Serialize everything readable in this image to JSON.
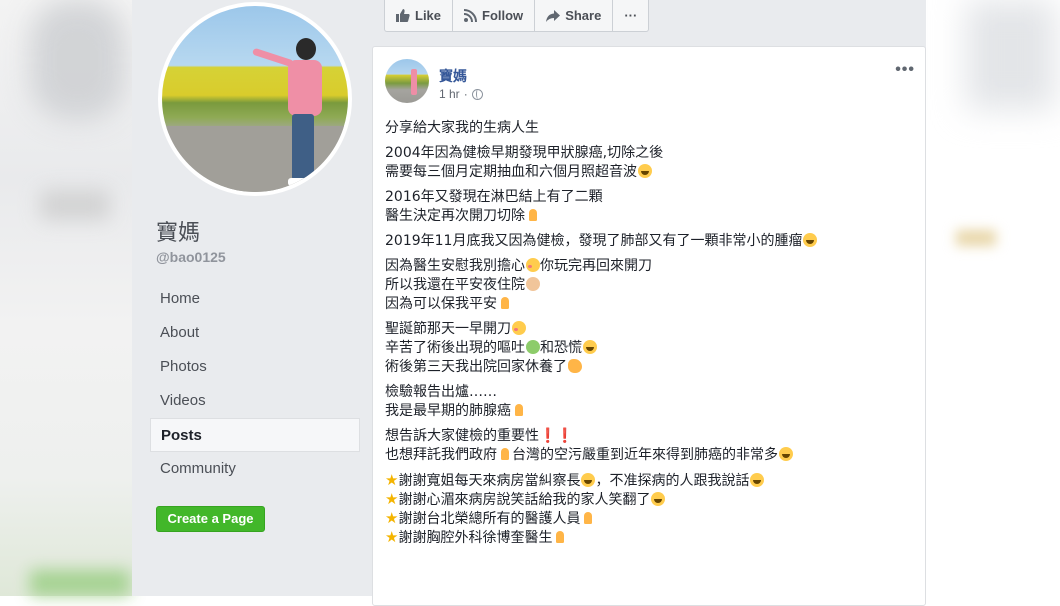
{
  "sidebar": {
    "page_name": "寶媽",
    "handle": "@bao0125",
    "nav": [
      "Home",
      "About",
      "Photos",
      "Videos",
      "Posts",
      "Community"
    ],
    "active_index": 4,
    "create_page_label": "Create a Page"
  },
  "actions": {
    "like": "Like",
    "follow": "Follow",
    "share": "Share",
    "more": "···"
  },
  "post": {
    "author": "寶媽",
    "time": "1 hr",
    "privacy_icon": "globe-icon",
    "lines": {
      "p1": "分享給大家我的生病人生",
      "p2a": "2004年因為健檢早期發現甲狀腺癌,切除之後",
      "p2b": "需要每三個月定期抽血和六個月照超音波",
      "p3a": "2016年又發現在淋巴結上有了二顆",
      "p3b": "醫生決定再次開刀切除",
      "p4": "2019年11月底我又因為健檢，發現了肺部又有了一顆非常小的腫瘤",
      "p5a1": "因為醫生安慰我別擔心",
      "p5a2": "你玩完再回來開刀",
      "p5b": "所以我還在平安夜住院",
      "p5c": "因為可以保我平安",
      "p6a": "聖誕節那天一早開刀",
      "p6b1": "辛苦了術後出現的嘔吐",
      "p6b2": "和恐慌",
      "p6c": "術後第三天我出院回家休養了",
      "p7a": "檢驗報告出爐……",
      "p7b": "我是最早期的肺腺癌",
      "p8a": "想告訴大家健檢的重要性",
      "p8a_marks": "❗❗",
      "p8b1": "也想拜託我們政府",
      "p8b2": "台灣的空污嚴重到近年來得到肺癌的非常多",
      "t1a": "謝謝寬姐每天來病房當糾察長",
      "t1b": "，不准探病的人跟我說話",
      "t2": "謝謝心湄來病房說笑話給我的家人笑翻了",
      "t3": "謝謝台北榮總所有的醫護人員",
      "t4": "謝謝胸腔外科徐博奎醫生"
    }
  }
}
